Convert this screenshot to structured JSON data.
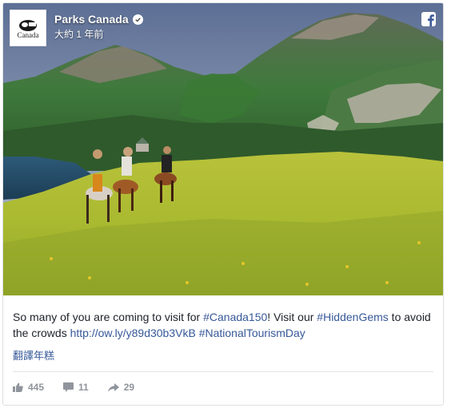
{
  "post": {
    "page_name": "Parks Canada",
    "timestamp": "大約 1 年前",
    "avatar_label": "Canada",
    "caption": {
      "part1": "So many of you are coming to visit for ",
      "hashtag1": "#Canada150",
      "part2": "! Visit our ",
      "hashtag2": "#HiddenGems",
      "part3": " to avoid the crowds ",
      "link": "http://ow.ly/y89d30b3VkB",
      "part4": " ",
      "hashtag3": "#NationalTourismDay"
    },
    "translate_label": "翻譯年糕",
    "stats": {
      "likes": "445",
      "comments": "11",
      "shares": "29"
    }
  },
  "colors": {
    "link": "#365899",
    "text": "#1d2129",
    "muted": "#90949c",
    "facebook_blue": "#3b5998"
  },
  "icons": [
    "facebook-icon",
    "verified-icon",
    "like-icon",
    "comment-icon",
    "share-icon",
    "beaver-logo-icon"
  ]
}
